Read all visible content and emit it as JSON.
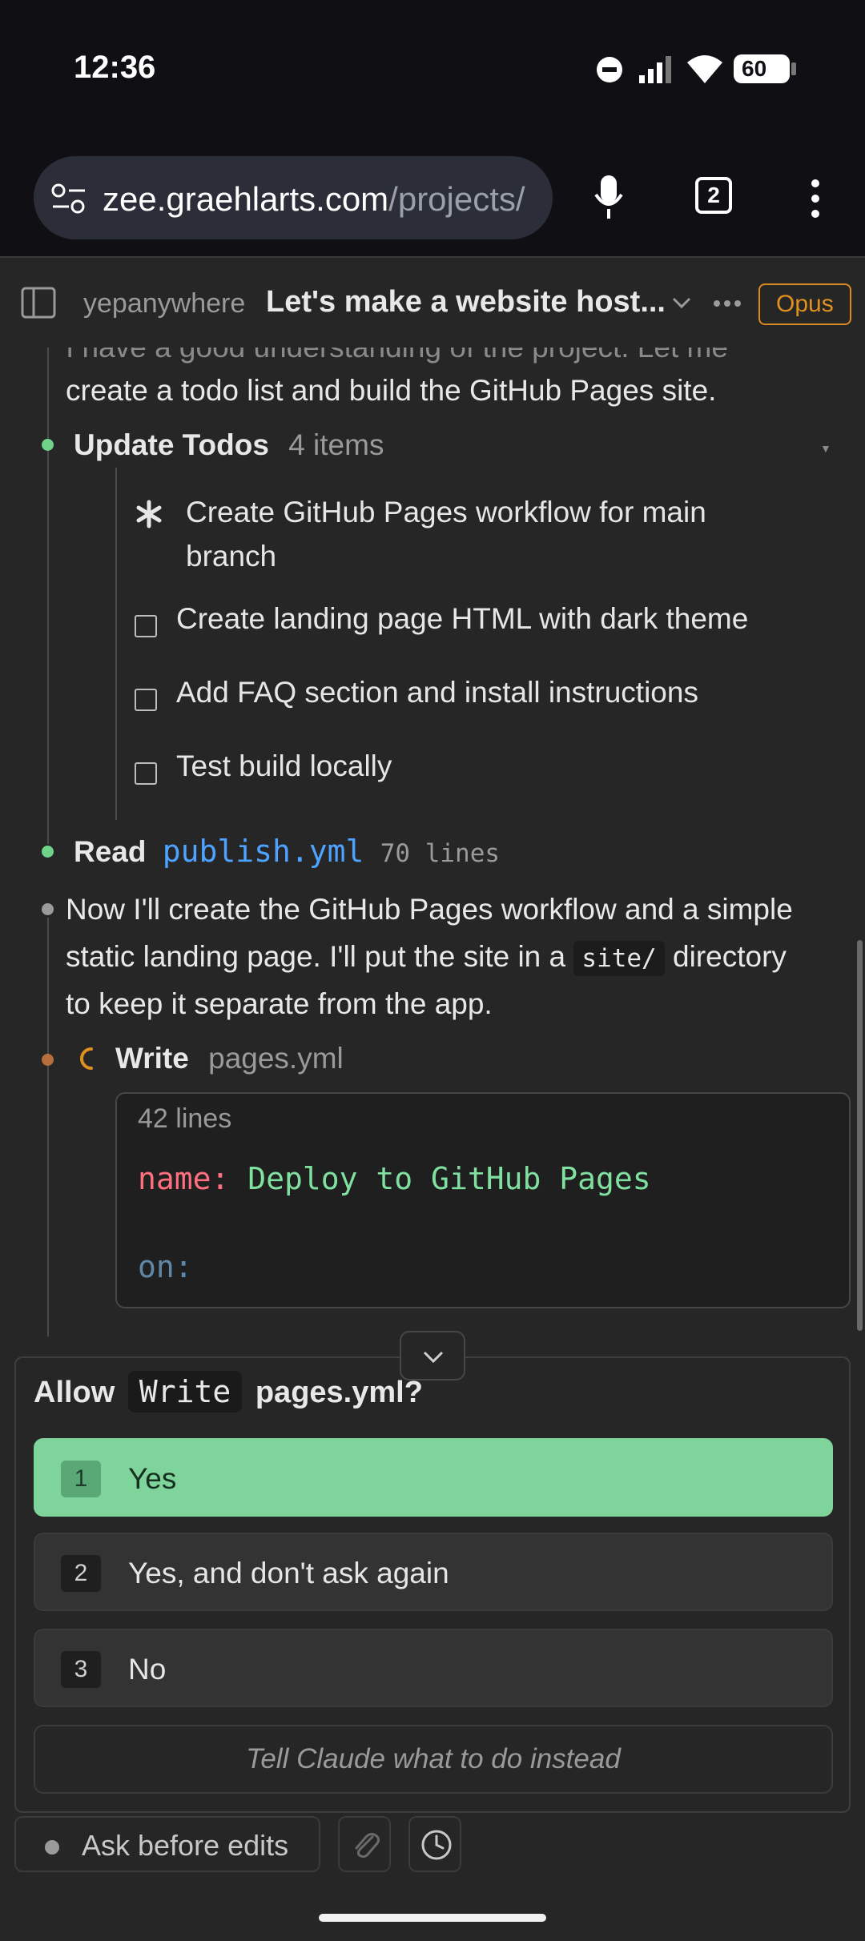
{
  "status_bar": {
    "time": "12:36",
    "battery": "60"
  },
  "browser": {
    "url_host": "zee.graehlarts.com",
    "url_path": "/projects/",
    "tab_count": "2"
  },
  "header": {
    "brand": "yepanywhere",
    "title": "Let's make a website host...",
    "model_badge": "Opus"
  },
  "chat": {
    "partial_line_1": "I have a good understanding of the project. Let me",
    "partial_line_2": "create a todo list and build the GitHub Pages site.",
    "update_todos": {
      "label": "Update Todos",
      "count": "4 items"
    },
    "todos": [
      {
        "line1": "Create GitHub Pages workflow for main",
        "line2": "branch",
        "state": "in_progress"
      },
      {
        "line1": "Create landing page HTML with dark theme",
        "state": "pending"
      },
      {
        "line1": "Add FAQ section and install instructions",
        "state": "pending"
      },
      {
        "line1": "Test build locally",
        "state": "pending"
      }
    ],
    "read_tool": {
      "label": "Read",
      "file": "publish.yml",
      "lines": "70 lines"
    },
    "message": {
      "line1": "Now I'll create the GitHub Pages workflow and a simple",
      "line2_pre": "static landing page. I'll put the site in a",
      "line2_code": "site/",
      "line2_post": "directory",
      "line3": "to keep it separate from the app."
    },
    "write_tool": {
      "label": "Write",
      "file": "pages.yml"
    },
    "code_preview": {
      "lines": "42 lines",
      "key1": "name:",
      "val1": "Deploy to GitHub Pages",
      "key2": "on:"
    }
  },
  "permission": {
    "allow_prefix": "Allow",
    "tool": "Write",
    "target": "pages.yml?",
    "options": [
      {
        "num": "1",
        "label": "Yes"
      },
      {
        "num": "2",
        "label": "Yes, and don't ask again"
      },
      {
        "num": "3",
        "label": "No"
      }
    ],
    "instead_placeholder": "Tell Claude what to do instead"
  },
  "bottom": {
    "mode_label": "Ask before edits"
  },
  "colors": {
    "accent_green": "#7fd49c",
    "dot_green": "#6fd38a",
    "opus_orange": "#e0901f",
    "link_blue": "#4da3ff",
    "yaml_key": "#ff6f7d",
    "yaml_value": "#7fe0a0"
  }
}
